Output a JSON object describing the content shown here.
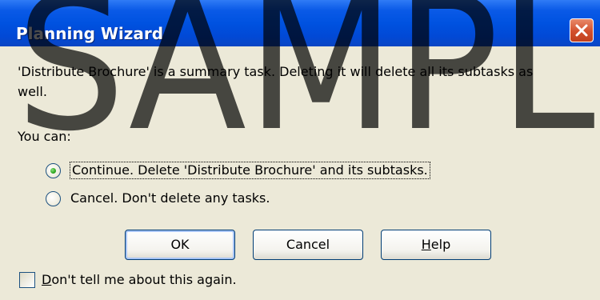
{
  "window": {
    "title": "Planning Wizard"
  },
  "message": {
    "line1": "'Distribute Brochure' is a summary task.  Deleting it will delete all its subtasks as",
    "line2": "well."
  },
  "prompt": "You can:",
  "options": [
    {
      "label": "Continue.  Delete 'Distribute Brochure' and its subtasks.",
      "selected": true
    },
    {
      "label": "Cancel.  Don't delete any tasks.",
      "selected": false
    }
  ],
  "buttons": {
    "ok": "OK",
    "cancel": "Cancel",
    "help_first": "H",
    "help_rest": "elp"
  },
  "dont_tell": {
    "first": "D",
    "rest": "on't tell me about this again.",
    "checked": false
  },
  "watermark": {
    "text": "SAMPLE",
    "color": "#000000"
  },
  "colors": {
    "titlebar": "#0052e0",
    "dialog_bg": "#ece9d8",
    "button_border": "#003c74",
    "radio_dot": "#2da71f"
  }
}
